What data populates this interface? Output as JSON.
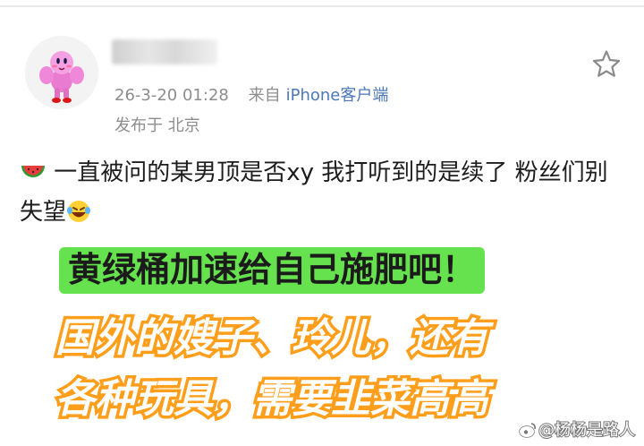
{
  "post": {
    "meta": {
      "date": "26-3-20 01:28",
      "source_prefix": "来自",
      "source": "iPhone客户端",
      "location": "发布于 北京"
    },
    "text_main": "一直被问的某男顶是否xy 我打听到的是续了 粉丝们别失望",
    "icons": {
      "leading_emoji": "watermelon-icon",
      "trailing_emoji": "laugh-cry-icon",
      "favorite": "star-icon"
    }
  },
  "overlay": {
    "headline": "黄绿桶加速给自己施肥吧！",
    "line1": "国外的嫂子、玲儿，还有",
    "line2": "各种玩具，需要韭菜高高"
  },
  "watermark": {
    "text": "@杨杨是路人"
  },
  "colors": {
    "source_link": "#4c78b8",
    "headline_bg": "#66e24e",
    "overlay_stroke": "#ff9e1a"
  }
}
